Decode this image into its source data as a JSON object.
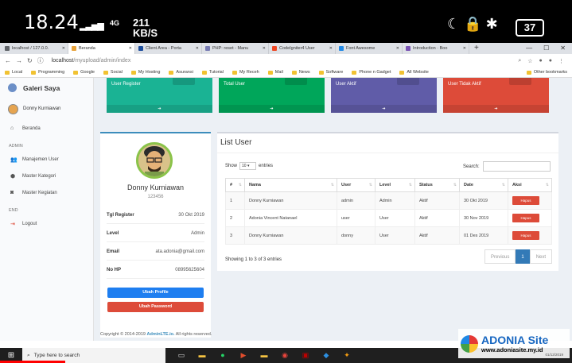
{
  "phone_status": {
    "time": "18.24",
    "signal": "..ıl",
    "network": "4G",
    "speed": "211\nKB/S",
    "battery": "37"
  },
  "browser": {
    "tabs": [
      {
        "label": "localhost / 127.0.0.",
        "active": false
      },
      {
        "label": "Beranda",
        "active": true
      },
      {
        "label": "Client Area - Porta",
        "active": false
      },
      {
        "label": "PHP: reset - Manu",
        "active": false
      },
      {
        "label": "CodeIgniter4 User",
        "active": false
      },
      {
        "label": "Font Awesome",
        "active": false
      },
      {
        "label": "Introduction · Boo",
        "active": false
      }
    ],
    "new_tab": "+",
    "url_host": "localhost",
    "url_path": "/myupload/admin/index",
    "bookmarks": [
      "Local",
      "Programming",
      "Google",
      "Social",
      "My Hosting",
      "Asuransi",
      "Tutorial",
      "My Receh",
      "Mail",
      "News",
      "Software",
      "Phone n Gadget",
      "All Website"
    ],
    "other_bookmarks": "Other bookmarks"
  },
  "sidebar": {
    "brand": "Galeri Saya",
    "user": "Donny Kurniawan",
    "items": [
      {
        "label": "Beranda",
        "icon": "home-icon"
      },
      {
        "header": "ADMIN"
      },
      {
        "label": "Manajemen User",
        "icon": "users-icon"
      },
      {
        "label": "Master Kategori",
        "icon": "tags-icon"
      },
      {
        "label": "Master Kegiatan",
        "icon": "camera-icon"
      },
      {
        "header": "END"
      },
      {
        "label": "Logout",
        "icon": "logout-icon"
      }
    ]
  },
  "stat_boxes": [
    {
      "label": "User Register",
      "color": "#00a65a"
    },
    {
      "label": "Total User",
      "color": "#00a65a"
    },
    {
      "label": "User Aktif",
      "color": "#605ca8"
    },
    {
      "label": "User Tidak Aktif",
      "color": "#dd4b39"
    }
  ],
  "profile": {
    "name": "Donny Kurniawan",
    "id": "123456",
    "rows": [
      {
        "key": "Tgl Register",
        "value": "30 Okt 2019"
      },
      {
        "key": "Level",
        "value": "Admin"
      },
      {
        "key": "Email",
        "value": "ata.adonia@gmail.com"
      },
      {
        "key": "No HP",
        "value": "08995625604"
      }
    ],
    "btn_profile": "Ubah Profile",
    "btn_password": "Ubah Password"
  },
  "list": {
    "title": "List User",
    "show_label": "Show",
    "show_value": "10",
    "entries_label": "entries",
    "search_label": "Search:",
    "columns": [
      "#",
      "Nama",
      "User",
      "Level",
      "Status",
      "Date",
      "Aksi"
    ],
    "rows": [
      [
        "1",
        "Donny Kurniawan",
        "admin",
        "Admin",
        "Aktif",
        "30 Okt 2019",
        "Hapus"
      ],
      [
        "2",
        "Adonia Vincent Natanael",
        "user",
        "User",
        "Aktif",
        "30 Nov 2019",
        "Hapus"
      ],
      [
        "3",
        "Donny Kurniawan",
        "donny",
        "User",
        "Aktif",
        "01 Des 2019",
        "Hapus"
      ]
    ],
    "info": "Showing 1 to 3 of 3 entries",
    "pager": {
      "prev": "Previous",
      "current": "1",
      "next": "Next"
    }
  },
  "footer": {
    "text": "Copyright © 2014-2019",
    "link": "AdminLTE.io.",
    "rights": "All rights reserved."
  },
  "taskbar": {
    "search_placeholder": "Type here to search"
  },
  "watermark": {
    "title": "ADONIA Site",
    "url": "www.adoniasite.my.id",
    "date": "01/12/2019"
  }
}
